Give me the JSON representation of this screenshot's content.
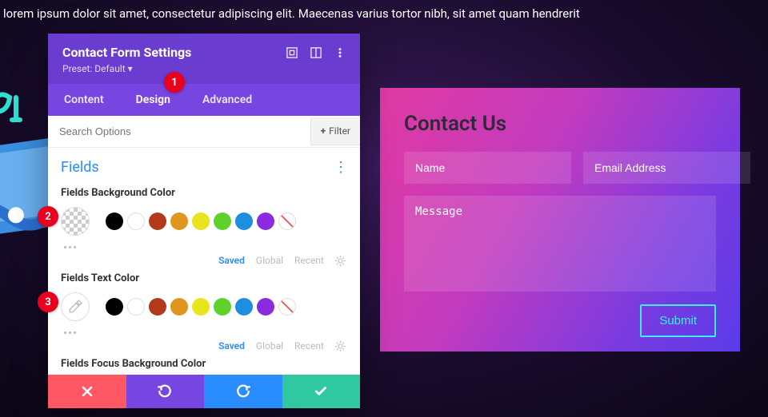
{
  "bg_text": "lorem ipsum dolor sit amet, consectetur adipiscing elit. Maecenas varius tortor nibh, sit amet                                                                                                                quam hendrerit",
  "panel": {
    "title": "Contact Form Settings",
    "preset": "Preset: Default ▾",
    "tabs": {
      "content": "Content",
      "design": "Design",
      "advanced": "Advanced"
    },
    "search_placeholder": "Search Options",
    "filter_label": "Filter",
    "section_title": "Fields",
    "field_bg_label": "Fields Background Color",
    "field_text_label": "Fields Text Color",
    "field_focus_bg_label": "Fields Focus Background Color",
    "meta": {
      "saved": "Saved",
      "global": "Global",
      "recent": "Recent"
    },
    "palette": [
      "#000000",
      "#ffffff",
      "#b23a1b",
      "#e0961e",
      "#e8e41e",
      "#5fd12a",
      "#1e8fe0",
      "#8a2be2"
    ]
  },
  "contact": {
    "title": "Contact Us",
    "name_placeholder": "Name",
    "email_placeholder": "Email Address",
    "message_placeholder": "Message",
    "submit_label": "Submit"
  },
  "badges": {
    "b1": "1",
    "b2": "2",
    "b3": "3"
  }
}
